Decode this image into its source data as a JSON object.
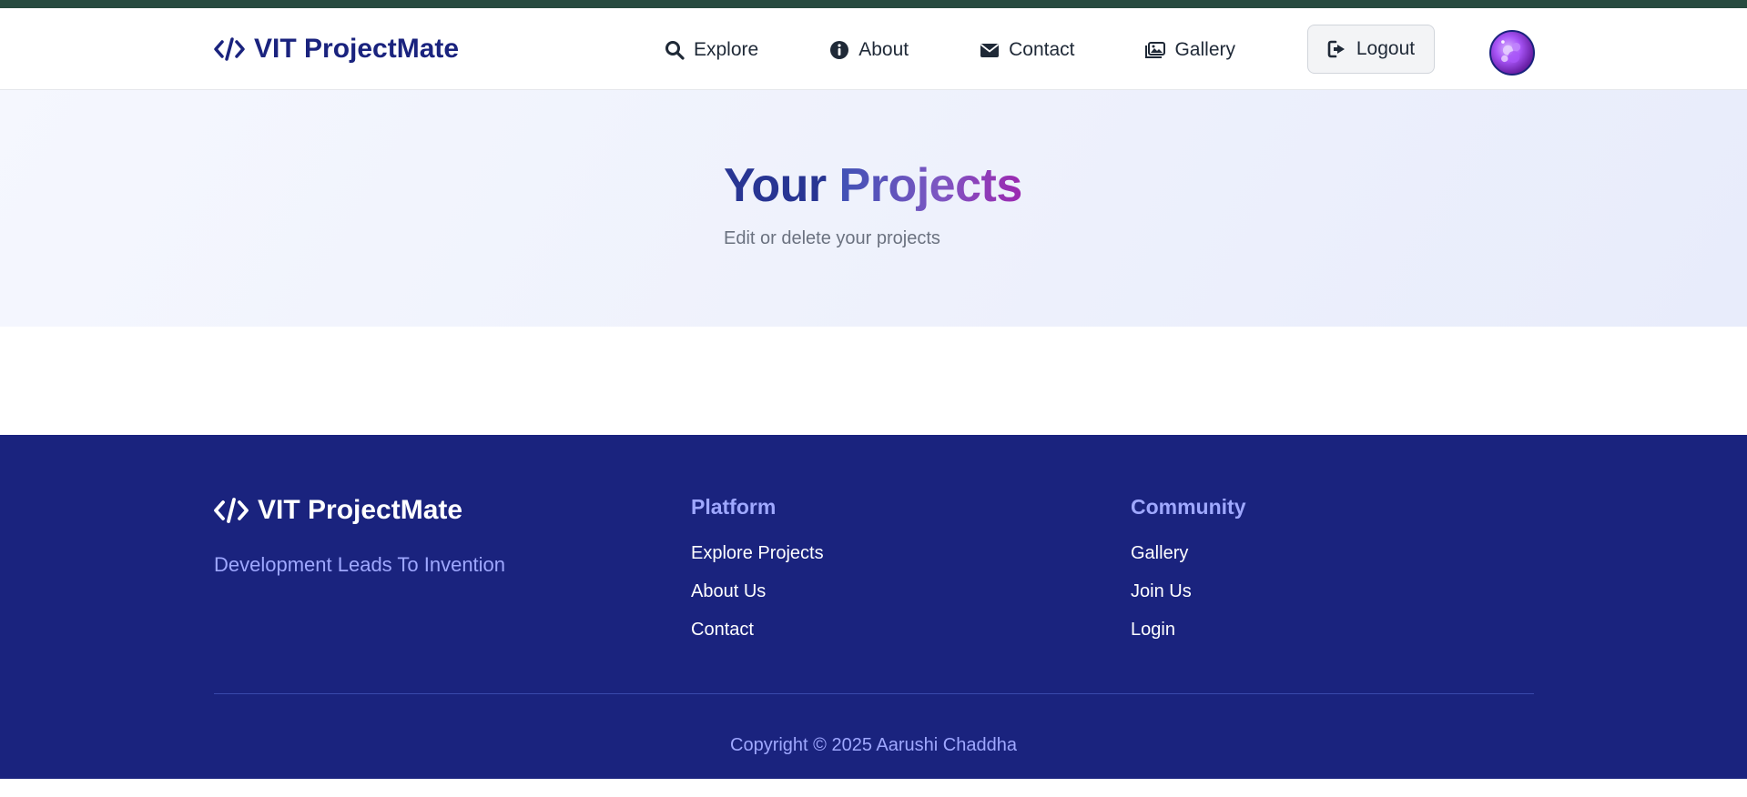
{
  "navbar": {
    "brand": "VIT ProjectMate",
    "links": [
      {
        "label": "Explore",
        "icon": "search-icon"
      },
      {
        "label": "About",
        "icon": "info-icon"
      },
      {
        "label": "Contact",
        "icon": "envelope-icon"
      },
      {
        "label": "Gallery",
        "icon": "images-icon"
      }
    ],
    "logout_label": "Logout"
  },
  "hero": {
    "title_part1": "Your",
    "title_part2": "Projects",
    "subtitle": "Edit or delete your projects"
  },
  "footer": {
    "brand": "VIT ProjectMate",
    "tagline": "Development Leads To Invention",
    "platform": {
      "heading": "Platform",
      "links": [
        "Explore Projects",
        "About Us",
        "Contact"
      ]
    },
    "community": {
      "heading": "Community",
      "links": [
        "Gallery",
        "Join Us",
        "Login"
      ]
    },
    "copyright": "Copyright © 2025 Aarushi Chaddha"
  },
  "colors": {
    "brand_navy": "#1a237e",
    "accent_light": "#9fa8ff",
    "top_strip": "#274a3f",
    "title_gradient_start": "#3f51b5",
    "title_gradient_end": "#9c27b0"
  }
}
